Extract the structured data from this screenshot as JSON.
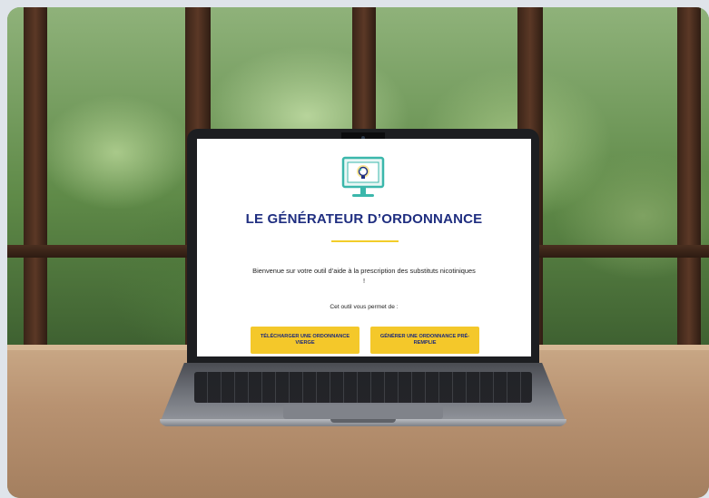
{
  "page": {
    "title": "LE GÉNÉRATEUR D’ORDONNANCE",
    "welcome": "Bienvenue sur votre outil d’aide à la prescription des substituts nicotiniques !",
    "lead": "Cet outil vous permet de :"
  },
  "buttons": {
    "download_blank": "TÉLÉCHARGER UNE ORDONNANCE VIERGE",
    "generate_prefilled": "GÉNÉRER UNE ORDONNANCE PRÉ-REMPLIE"
  },
  "colors": {
    "title": "#1f2e80",
    "accent_line": "#f2cd2a",
    "button_bg": "#f4c82a",
    "button_text": "#1d2a7a",
    "logo_teal": "#3bb7ab"
  },
  "icons": {
    "logo": "monitor-with-lightbulb-icon"
  }
}
